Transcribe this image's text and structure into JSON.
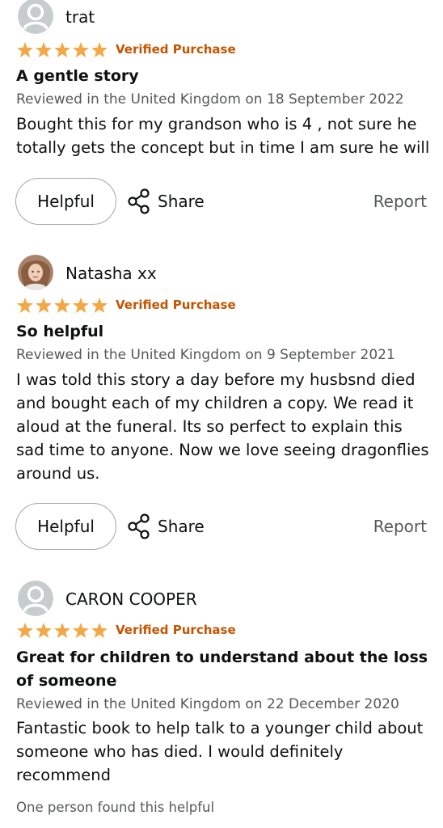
{
  "reviews": [
    {
      "reviewer": "trat",
      "avatar": "default-avatar-icon",
      "rating": 5,
      "verified_label": "Verified Purchase",
      "title": "A gentle story",
      "meta": "Reviewed in the United Kingdom on 18 September 2022",
      "body": "Bought this for my grandson who is 4 , not sure he totally gets the concept but in time I am sure he will",
      "helpful_label": "Helpful",
      "share_label": "Share",
      "report_label": "Report"
    },
    {
      "reviewer": "Natasha xx",
      "avatar": "user-photo-avatar",
      "rating": 5,
      "verified_label": "Verified Purchase",
      "title": "So helpful",
      "meta": "Reviewed in the United Kingdom on 9 September 2021",
      "body": "I was told this story a day before my husbsnd died and bought each of my children a copy. We read it aloud at the funeral. Its so perfect to explain this sad time to anyone. Now we love seeing dragonflies around us.",
      "helpful_label": "Helpful",
      "share_label": "Share",
      "report_label": "Report"
    },
    {
      "reviewer": "CARON COOPER",
      "avatar": "default-avatar-icon",
      "rating": 5,
      "verified_label": "Verified Purchase",
      "title": "Great for children to understand about the loss of someone",
      "meta": "Reviewed in the United Kingdom on 22 December 2020",
      "body": "Fantastic book to help talk to a younger child about someone who has died. I would definitely recommend",
      "found_helpful": "One person found this helpful"
    }
  ],
  "colors": {
    "star": "#f3a847",
    "verified": "#c45500",
    "secondary_text": "#565959"
  }
}
